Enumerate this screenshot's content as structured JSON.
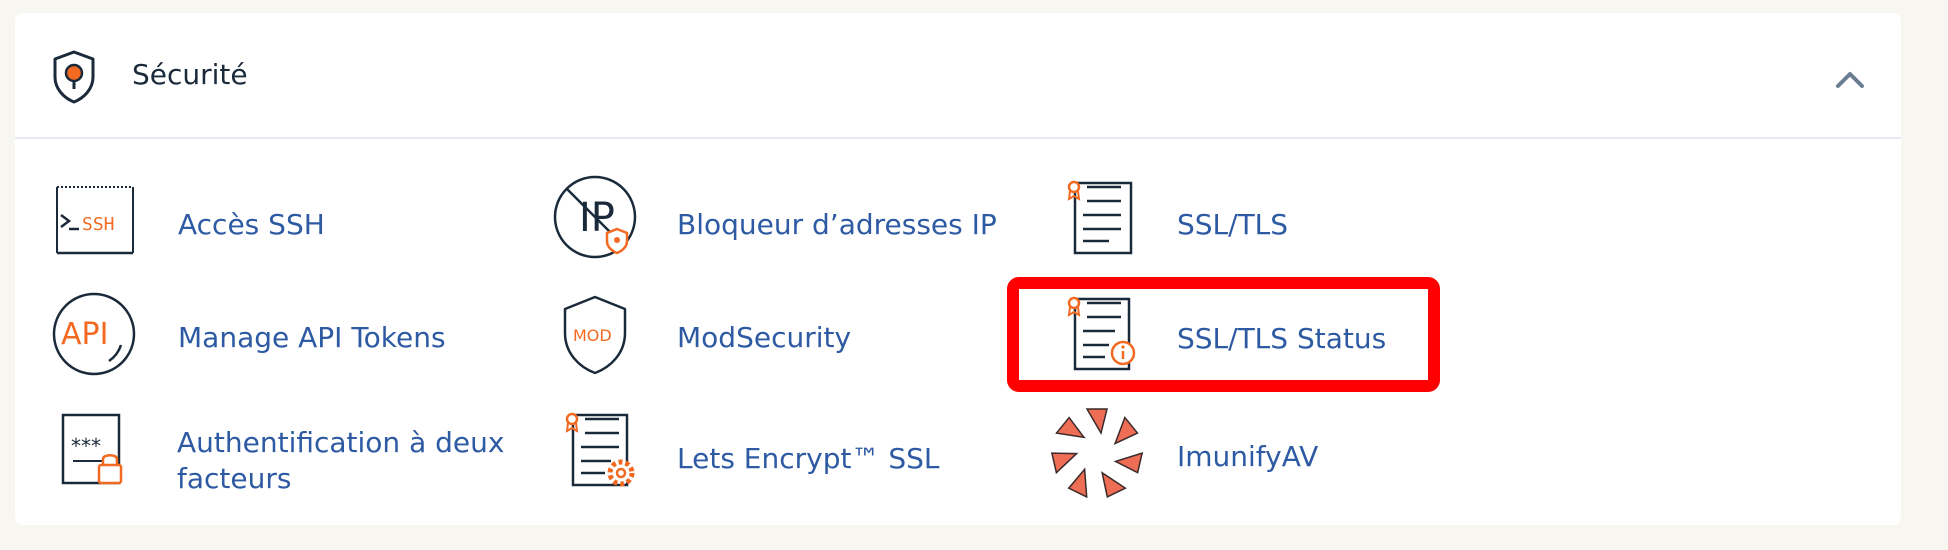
{
  "section": {
    "title": "Sécurité",
    "header_icon": "shield-pin-icon",
    "toggle_icon": "chevron-up-icon"
  },
  "tools": [
    {
      "label": "Accès SSH",
      "icon": "ssh-terminal-icon",
      "icon_text": "SSH"
    },
    {
      "label": "Bloqueur d’adresses IP",
      "icon": "ip-blocker-icon",
      "icon_text": "IP"
    },
    {
      "label": "SSL/TLS",
      "icon": "certificate-icon"
    },
    {
      "label": "Manage API Tokens",
      "icon": "api-icon",
      "icon_text": "API"
    },
    {
      "label": "ModSecurity",
      "icon": "mod-shield-icon",
      "icon_text": "MOD"
    },
    {
      "label": "SSL/TLS Status",
      "icon": "certificate-info-icon"
    },
    {
      "label_line1": "Authentification à deux",
      "label_line2": "facteurs",
      "icon": "two-factor-icon",
      "icon_text": "***"
    },
    {
      "label": "Lets Encrypt™ SSL",
      "icon": "certificate-gear-icon"
    },
    {
      "label": "ImunifyAV",
      "icon": "imunify-icon"
    }
  ],
  "colors": {
    "accent_orange": "#f26a21",
    "link_blue": "#2d5aa3",
    "highlight_red": "#ff0000",
    "imunify_salmon": "#ee6d55"
  }
}
